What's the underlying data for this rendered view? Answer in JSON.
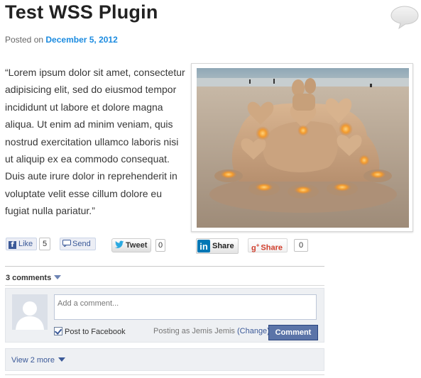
{
  "post": {
    "title": "Test WSS Plugin",
    "posted_prefix": "Posted on ",
    "date": "December 5, 2012",
    "quote": "“Lorem ipsum dolor sit amet, consectetur adipisicing elit, sed do eiusmod tempor incididunt ut labore et dolore magna aliqua. Ut enim ad minim veniam, quis nostrud exercitation ullamco laboris nisi ut aliquip ex ea commodo consequat. Duis aute irure dolor in reprehenderit in voluptate velit esse cillum dolore eu fugiat nulla pariatur.”"
  },
  "social": {
    "fb_like_label": "Like",
    "fb_like_count": "5",
    "fb_send_label": "Send",
    "tweet_label": "Tweet",
    "tweet_count": "0",
    "linkedin_label": "Share",
    "gplus_label": "Share",
    "gplus_count": "0"
  },
  "comments": {
    "count_label": "3 comments",
    "input_placeholder": "Add a comment...",
    "post_to_facebook_label": "Post to Facebook",
    "posting_as_label": "Posting as Jemis Jemis ",
    "change_label": "(Change)",
    "submit_label": "Comment",
    "view_more_label": "View 2 more"
  },
  "icons": {
    "comment_bubble": "speech-bubble-icon",
    "fb": "facebook-icon",
    "send": "send-icon",
    "twitter": "twitter-bird-icon",
    "linkedin": "linkedin-icon",
    "gplus": "google-plus-icon",
    "caret": "chevron-down-icon"
  },
  "colors": {
    "link_blue": "#1b8be0",
    "facebook_blue": "#3b5998",
    "comment_button": "#5b74a8"
  }
}
